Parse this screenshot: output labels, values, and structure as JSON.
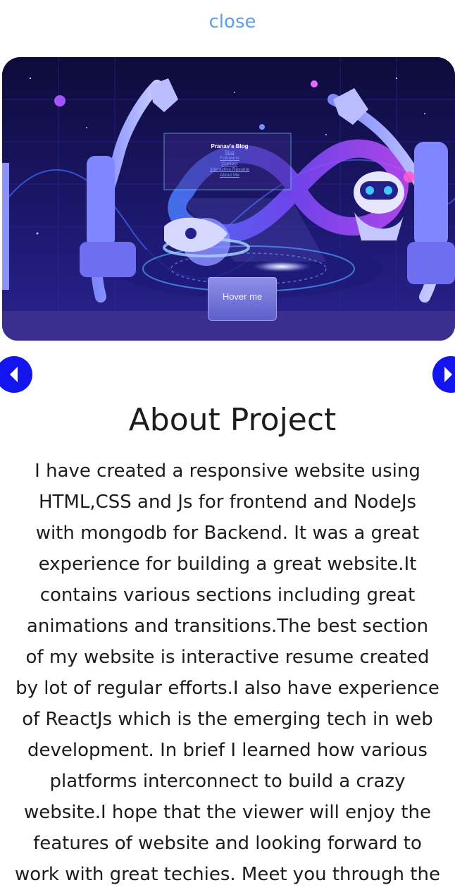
{
  "close_label": "close",
  "hero": {
    "blog_title": "Pranav's Blog",
    "blog_links": [
      "Blog",
      "Followme",
      "Contact",
      "Interactive Resume",
      "About Me"
    ],
    "hover_button_label": "Hover me"
  },
  "nav": {
    "prev_icon": "chevron-left-icon",
    "next_icon": "chevron-right-icon",
    "accent_color": "#1414ee"
  },
  "about": {
    "title": "About Project",
    "lines": [
      "I have created a responsive website using",
      "HTML,CSS and Js for frontend and NodeJs",
      "with mongodb for Backend. It was a great",
      "experience for building a great website.It",
      "contains various sections including great",
      "animations and transitions.The best section",
      "of my website is interactive resume created",
      "by lot of regular efforts.I also have experience",
      "of ReactJs which is the emerging tech in web",
      "development. In brief I learned how various",
      "platforms interconnect to build a crazy",
      "website.I hope that the viewer will enjoy the",
      "features of website and looking forward to",
      "work with great techies. Meet you through the"
    ]
  },
  "colors": {
    "link": "#5b9ef2",
    "text": "#1c1c1c",
    "hero_bg": "#13104a"
  }
}
